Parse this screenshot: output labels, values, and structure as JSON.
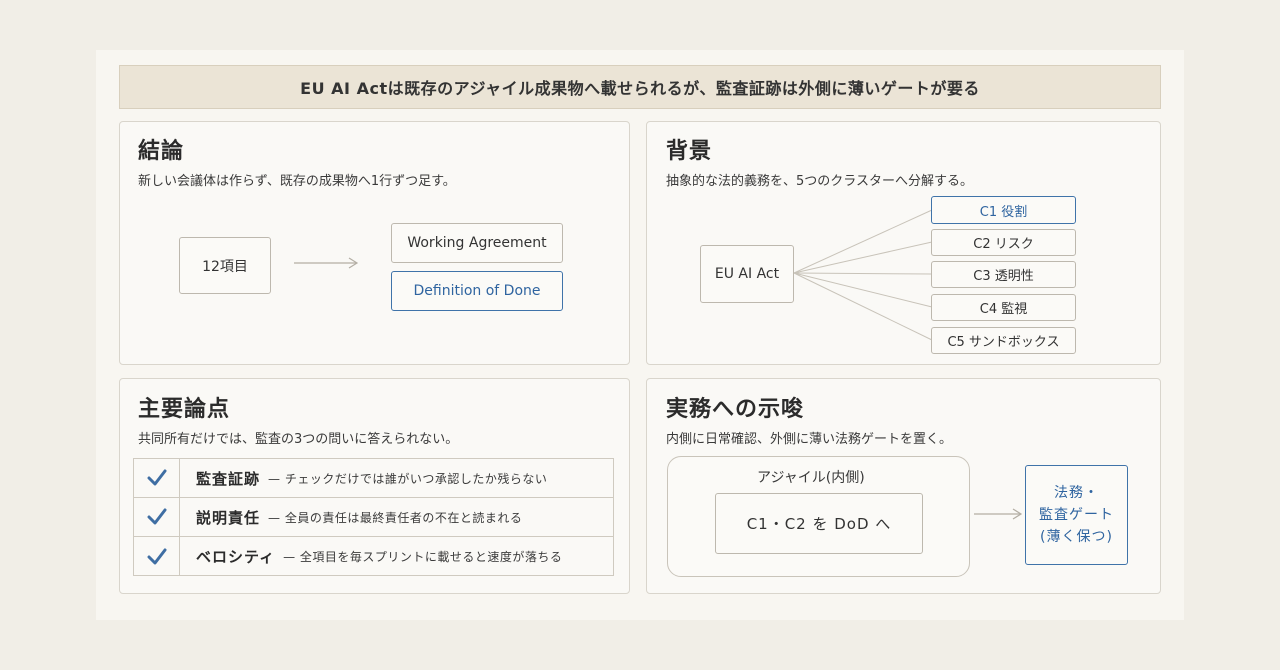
{
  "banner": "EU AI Actは既存のアジャイル成果物へ載せられるが、監査証跡は外側に薄いゲートが要る",
  "conclusion": {
    "title": "結論",
    "subtitle": "新しい会議体は作らず、既存の成果物へ1行ずつ足す。",
    "source": "12項目",
    "targets": [
      "Working Agreement",
      "Definition of Done"
    ]
  },
  "background": {
    "title": "背景",
    "subtitle": "抽象的な法的義務を、5つのクラスターへ分解する。",
    "root": "EU AI Act",
    "clusters": [
      "C1 役割",
      "C2 リスク",
      "C3 透明性",
      "C4 監視",
      "C5 サンドボックス"
    ]
  },
  "issues": {
    "title": "主要論点",
    "subtitle": "共同所有だけでは、監査の3つの問いに答えられない。",
    "rows": [
      {
        "key": "監査証跡",
        "desc": "— チェックだけでは誰がいつ承認したか残らない"
      },
      {
        "key": "説明責任",
        "desc": "— 全員の責任は最終責任者の不在と読まれる"
      },
      {
        "key": "ベロシティ",
        "desc": "— 全項目を毎スプリントに載せると速度が落ちる"
      }
    ]
  },
  "implications": {
    "title": "実務への示唆",
    "subtitle": "内側に日常確認、外側に薄い法務ゲートを置く。",
    "agile_label": "アジャイル(内側)",
    "inner_box": "C1・C2 を DoD へ",
    "gate_line1": "法務・",
    "gate_line2": "監査ゲート",
    "gate_line3": "(薄く保つ)"
  },
  "colors": {
    "accent_blue": "#3f73a9",
    "banner_bg": "#ebe4d6"
  }
}
